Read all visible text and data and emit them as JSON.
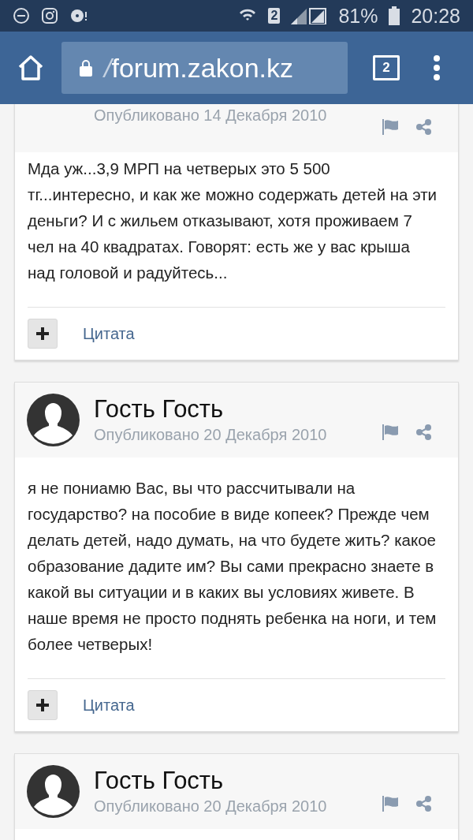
{
  "status_bar": {
    "battery": "81%",
    "time": "20:28",
    "sim": "2"
  },
  "browser": {
    "url_prefix": "/",
    "url": "forum.zakon.kz",
    "tab_count": "2"
  },
  "posts": [
    {
      "kind": "cut",
      "date": "Опубликовано 14 Декабря 2010",
      "text": "Мда уж...3,9 МРП на четверых это 5 500 тг...интересно, и как же можно содержать детей на эти деньги? И с жильем отказывают, хотя проживаем 7 чел на 40 квадратах. Говорят: есть же у вас крыша над головой и радуйтесь...",
      "quote": "Цитата"
    },
    {
      "kind": "full",
      "author": "Гость Гость",
      "date": "Опубликовано 20 Декабря 2010",
      "text": "я не пониамю Вас, вы что рассчитывали на государство? на пособие в виде копеек? Прежде чем делать детей, надо думать, на что будете жить? какое образование дадите им? Вы сами прекрасно знаете в какой вы ситуации и в каких вы условиях живете. В наше время не просто поднять ребенка на ноги, и тем более четверых!",
      "quote": "Цитата"
    },
    {
      "kind": "head",
      "author": "Гость Гость",
      "date": "Опубликовано 20 Декабря 2010"
    }
  ]
}
